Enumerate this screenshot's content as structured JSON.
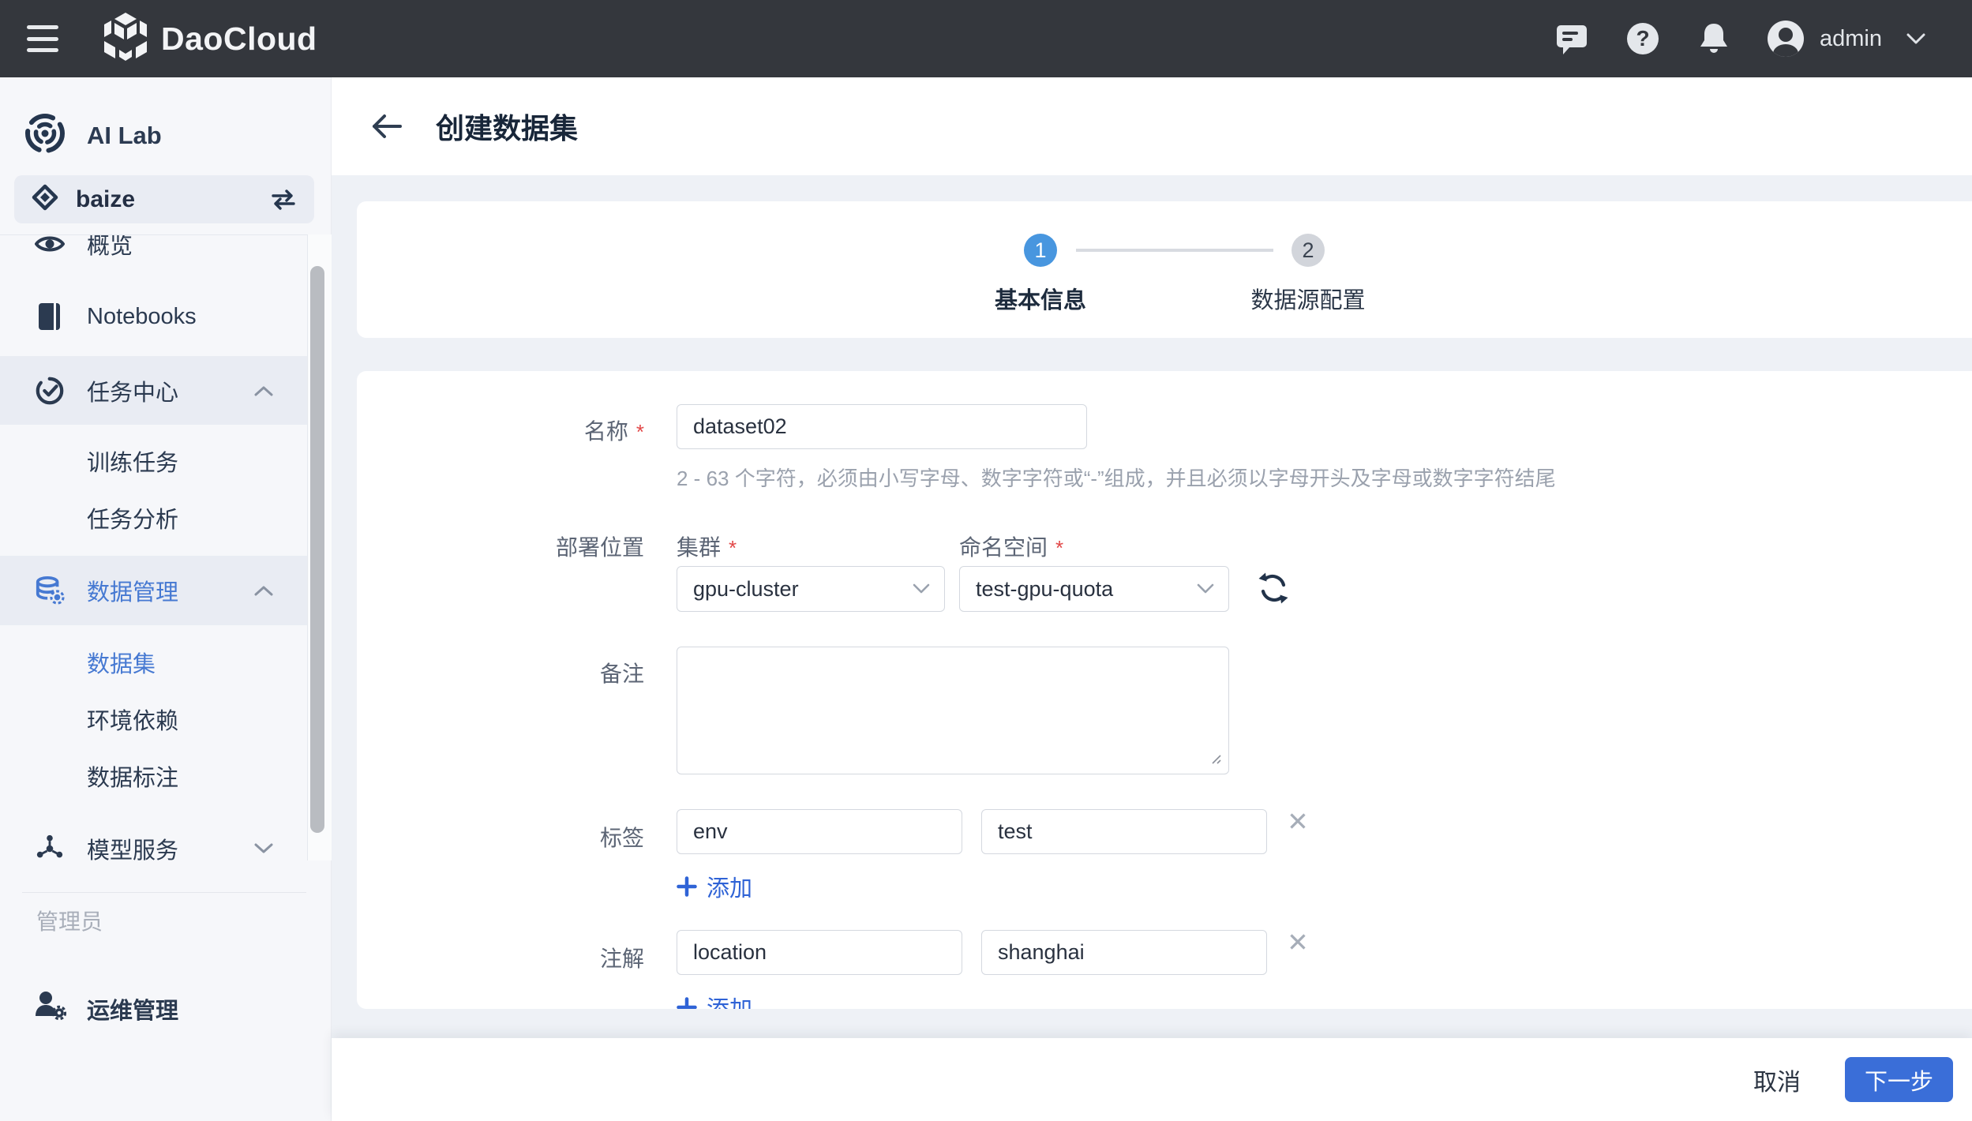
{
  "topbar": {
    "brand": "DaoCloud",
    "user": "admin"
  },
  "sidebar": {
    "product": "AI Lab",
    "workspace": "baize",
    "nav": {
      "overview": "概览",
      "notebooks": "Notebooks",
      "task_center": "任务中心",
      "training_jobs": "训练任务",
      "job_analysis": "任务分析",
      "data_management": "数据管理",
      "datasets": "数据集",
      "env_dependencies": "环境依赖",
      "data_annotation": "数据标注",
      "model_service": "模型服务"
    },
    "section_label": "管理员",
    "ops": "运维管理"
  },
  "page": {
    "title": "创建数据集",
    "steps": {
      "s1_num": "1",
      "s1_label": "基本信息",
      "s2_num": "2",
      "s2_label": "数据源配置"
    },
    "form": {
      "name_label": "名称",
      "name_value": "dataset02",
      "name_help": "2 - 63 个字符，必须由小写字母、数字字符或“-”组成，并且必须以字母开头及字母或数字字符结尾",
      "deploy_label": "部署位置",
      "cluster_label": "集群",
      "cluster_value": "gpu-cluster",
      "namespace_label": "命名空间",
      "namespace_value": "test-gpu-quota",
      "remark_label": "备注",
      "labels_label": "标签",
      "label_key": "env",
      "label_value": "test",
      "add_label": "添加",
      "annotations_label": "注解",
      "annotation_key": "location",
      "annotation_value": "shanghai"
    },
    "footer": {
      "cancel": "取消",
      "next": "下一步"
    }
  },
  "colors": {
    "topbar_bg": "#34373d",
    "accent_blue": "#3a6ed8",
    "step_active_blue": "#4896df",
    "link_blue": "#2f63d6",
    "sidebar_active_blue": "#4679d2",
    "required_red": "#e24848"
  }
}
